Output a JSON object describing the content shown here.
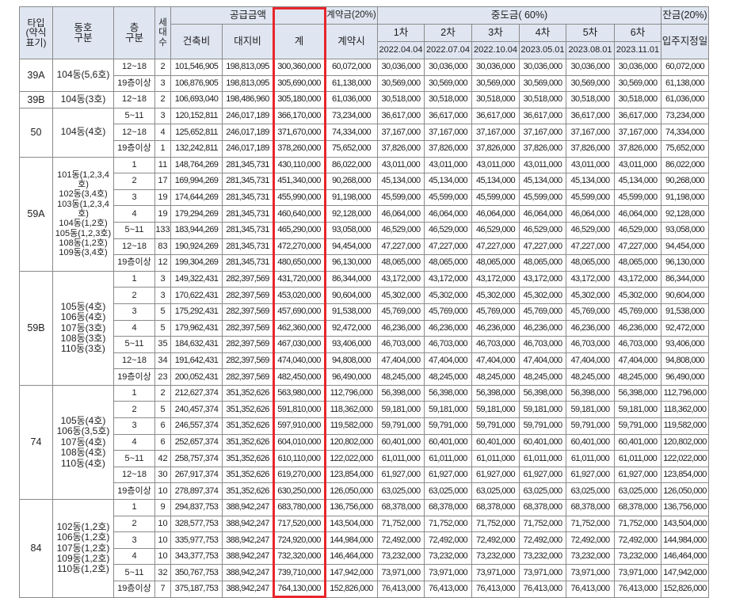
{
  "header": {
    "type_label": "타입\n(약식\n표기)",
    "dong_label": "동호\n구분",
    "floor_label": "층\n구분",
    "units_label": "세\n대\n수",
    "supply_group": "공급금액",
    "building": "건축비",
    "land": "대지비",
    "total": "계",
    "contract_group": "계약금(20%)",
    "contract_sub": "계약시",
    "middle_group": "중도금( 60%)",
    "installments": [
      {
        "label": "1차",
        "date": "2022.04.04"
      },
      {
        "label": "2차",
        "date": "2022.07.04"
      },
      {
        "label": "3차",
        "date": "2022.10.04"
      },
      {
        "label": "4차",
        "date": "2023.05.01"
      },
      {
        "label": "5차",
        "date": "2023.08.01"
      },
      {
        "label": "6차",
        "date": "2023.11.01"
      }
    ],
    "balance_group": "잔금(20%)",
    "balance_sub": "입주지정일"
  },
  "groups": [
    {
      "type": "39A",
      "dong": [
        "104동(5,6호)"
      ],
      "rows": [
        {
          "floor": "12~18",
          "units": "2",
          "building": "101,546,905",
          "land": "198,813,095",
          "total": "300,360,000",
          "contract": "60,072,000",
          "mid": "30,036,000",
          "balance": "60,072,000"
        },
        {
          "floor": "19층이상",
          "units": "3",
          "building": "106,876,905",
          "land": "198,813,095",
          "total": "305,690,000",
          "contract": "61,138,000",
          "mid": "30,569,000",
          "balance": "61,138,000"
        }
      ]
    },
    {
      "type": "39B",
      "dong": [
        "104동(3호)"
      ],
      "rows": [
        {
          "floor": "12~18",
          "units": "2",
          "building": "106,693,040",
          "land": "198,486,960",
          "total": "305,180,000",
          "contract": "61,036,000",
          "mid": "30,518,000",
          "balance": "61,036,000"
        }
      ]
    },
    {
      "type": "50",
      "dong": [
        "104동(4호)"
      ],
      "rows": [
        {
          "floor": "5~11",
          "units": "3",
          "building": "120,152,811",
          "land": "246,017,189",
          "total": "366,170,000",
          "contract": "73,234,000",
          "mid": "36,617,000",
          "balance": "73,234,000"
        },
        {
          "floor": "12~18",
          "units": "4",
          "building": "125,652,811",
          "land": "246,017,189",
          "total": "371,670,000",
          "contract": "74,334,000",
          "mid": "37,167,000",
          "balance": "74,334,000"
        },
        {
          "floor": "19층이상",
          "units": "1",
          "building": "132,242,811",
          "land": "246,017,189",
          "total": "378,260,000",
          "contract": "75,652,000",
          "mid": "37,826,000",
          "balance": "75,652,000"
        }
      ]
    },
    {
      "type": "59A",
      "dong": [
        "101동(1,2,3,4호)",
        "102동(3,4호)",
        "103동(1,2,3,4호)",
        "104동(1,2호)",
        "105동(1,2,3호)",
        "108동(1,2호)",
        "109동(3,4호)"
      ],
      "rows": [
        {
          "floor": "1",
          "units": "11",
          "building": "148,764,269",
          "land": "281,345,731",
          "total": "430,110,000",
          "contract": "86,022,000",
          "mid": "43,011,000",
          "balance": "86,022,000"
        },
        {
          "floor": "2",
          "units": "17",
          "building": "169,994,269",
          "land": "281,345,731",
          "total": "451,340,000",
          "contract": "90,268,000",
          "mid": "45,134,000",
          "balance": "90,268,000"
        },
        {
          "floor": "3",
          "units": "19",
          "building": "174,644,269",
          "land": "281,345,731",
          "total": "455,990,000",
          "contract": "91,198,000",
          "mid": "45,599,000",
          "balance": "91,198,000"
        },
        {
          "floor": "4",
          "units": "19",
          "building": "179,294,269",
          "land": "281,345,731",
          "total": "460,640,000",
          "contract": "92,128,000",
          "mid": "46,064,000",
          "balance": "92,128,000"
        },
        {
          "floor": "5~11",
          "units": "133",
          "building": "183,944,269",
          "land": "281,345,731",
          "total": "465,290,000",
          "contract": "93,058,000",
          "mid": "46,529,000",
          "balance": "93,058,000"
        },
        {
          "floor": "12~18",
          "units": "83",
          "building": "190,924,269",
          "land": "281,345,731",
          "total": "472,270,000",
          "contract": "94,454,000",
          "mid": "47,227,000",
          "balance": "94,454,000"
        },
        {
          "floor": "19층이상",
          "units": "12",
          "building": "199,304,269",
          "land": "281,345,731",
          "total": "480,650,000",
          "contract": "96,130,000",
          "mid": "48,065,000",
          "balance": "96,130,000"
        }
      ]
    },
    {
      "type": "59B",
      "dong": [
        "105동(4호)",
        "106동(4호)",
        "107동(3호)",
        "108동(3호)",
        "110동(3호)"
      ],
      "rows": [
        {
          "floor": "1",
          "units": "3",
          "building": "149,322,431",
          "land": "282,397,569",
          "total": "431,720,000",
          "contract": "86,344,000",
          "mid": "43,172,000",
          "balance": "86,344,000"
        },
        {
          "floor": "2",
          "units": "3",
          "building": "170,622,431",
          "land": "282,397,569",
          "total": "453,020,000",
          "contract": "90,604,000",
          "mid": "45,302,000",
          "balance": "90,604,000"
        },
        {
          "floor": "3",
          "units": "5",
          "building": "175,292,431",
          "land": "282,397,569",
          "total": "457,690,000",
          "contract": "91,538,000",
          "mid": "45,769,000",
          "balance": "91,538,000"
        },
        {
          "floor": "4",
          "units": "5",
          "building": "179,962,431",
          "land": "282,397,569",
          "total": "462,360,000",
          "contract": "92,472,000",
          "mid": "46,236,000",
          "balance": "92,472,000"
        },
        {
          "floor": "5~11",
          "units": "35",
          "building": "184,632,431",
          "land": "282,397,569",
          "total": "467,030,000",
          "contract": "93,406,000",
          "mid": "46,703,000",
          "balance": "93,406,000"
        },
        {
          "floor": "12~18",
          "units": "34",
          "building": "191,642,431",
          "land": "282,397,569",
          "total": "474,040,000",
          "contract": "94,808,000",
          "mid": "47,404,000",
          "balance": "94,808,000"
        },
        {
          "floor": "19층이상",
          "units": "23",
          "building": "200,052,431",
          "land": "282,397,569",
          "total": "482,450,000",
          "contract": "96,490,000",
          "mid": "48,245,000",
          "balance": "96,490,000"
        }
      ]
    },
    {
      "type": "74",
      "dong": [
        "105동(4호)",
        "106동(3,5호)",
        "107동(4호)",
        "108동(4호)",
        "110동(4호)"
      ],
      "rows": [
        {
          "floor": "1",
          "units": "2",
          "building": "212,627,374",
          "land": "351,352,626",
          "total": "563,980,000",
          "contract": "112,796,000",
          "mid": "56,398,000",
          "balance": "112,796,000"
        },
        {
          "floor": "2",
          "units": "5",
          "building": "240,457,374",
          "land": "351,352,626",
          "total": "591,810,000",
          "contract": "118,362,000",
          "mid": "59,181,000",
          "balance": "118,362,000"
        },
        {
          "floor": "3",
          "units": "6",
          "building": "246,557,374",
          "land": "351,352,626",
          "total": "597,910,000",
          "contract": "119,582,000",
          "mid": "59,791,000",
          "balance": "119,582,000"
        },
        {
          "floor": "4",
          "units": "6",
          "building": "252,657,374",
          "land": "351,352,626",
          "total": "604,010,000",
          "contract": "120,802,000",
          "mid": "60,401,000",
          "balance": "120,802,000"
        },
        {
          "floor": "5~11",
          "units": "42",
          "building": "258,757,374",
          "land": "351,352,626",
          "total": "610,110,000",
          "contract": "122,022,000",
          "mid": "61,011,000",
          "balance": "122,022,000"
        },
        {
          "floor": "12~18",
          "units": "30",
          "building": "267,917,374",
          "land": "351,352,626",
          "total": "619,270,000",
          "contract": "123,854,000",
          "mid": "61,927,000",
          "balance": "123,854,000"
        },
        {
          "floor": "19층이상",
          "units": "10",
          "building": "278,897,374",
          "land": "351,352,626",
          "total": "630,250,000",
          "contract": "126,050,000",
          "mid": "63,025,000",
          "balance": "126,050,000"
        }
      ]
    },
    {
      "type": "84",
      "dong": [
        "102동(1,2호)",
        "106동(1,2호)",
        "107동(1,2호)",
        "109동(1,2호)",
        "110동(1,2호)"
      ],
      "rows": [
        {
          "floor": "1",
          "units": "9",
          "building": "294,837,753",
          "land": "388,942,247",
          "total": "683,780,000",
          "contract": "136,756,000",
          "mid": "68,378,000",
          "balance": "136,756,000"
        },
        {
          "floor": "2",
          "units": "10",
          "building": "328,577,753",
          "land": "388,942,247",
          "total": "717,520,000",
          "contract": "143,504,000",
          "mid": "71,752,000",
          "balance": "143,504,000"
        },
        {
          "floor": "3",
          "units": "10",
          "building": "335,977,753",
          "land": "388,942,247",
          "total": "724,920,000",
          "contract": "144,984,000",
          "mid": "72,492,000",
          "balance": "144,984,000"
        },
        {
          "floor": "4",
          "units": "10",
          "building": "343,377,753",
          "land": "388,942,247",
          "total": "732,320,000",
          "contract": "146,464,000",
          "mid": "73,232,000",
          "balance": "146,464,000"
        },
        {
          "floor": "5~11",
          "units": "32",
          "building": "350,767,753",
          "land": "388,942,247",
          "total": "739,710,000",
          "contract": "147,942,000",
          "mid": "73,971,000",
          "balance": "147,942,000"
        },
        {
          "floor": "19층이상",
          "units": "7",
          "building": "375,187,753",
          "land": "388,942,247",
          "total": "764,130,000",
          "contract": "152,826,000",
          "mid": "76,413,000",
          "balance": "152,826,000"
        }
      ]
    }
  ],
  "colors": {
    "header_bg": "#dfe6f1",
    "highlight": "#e8262c",
    "grid": "#8a8a8a"
  }
}
